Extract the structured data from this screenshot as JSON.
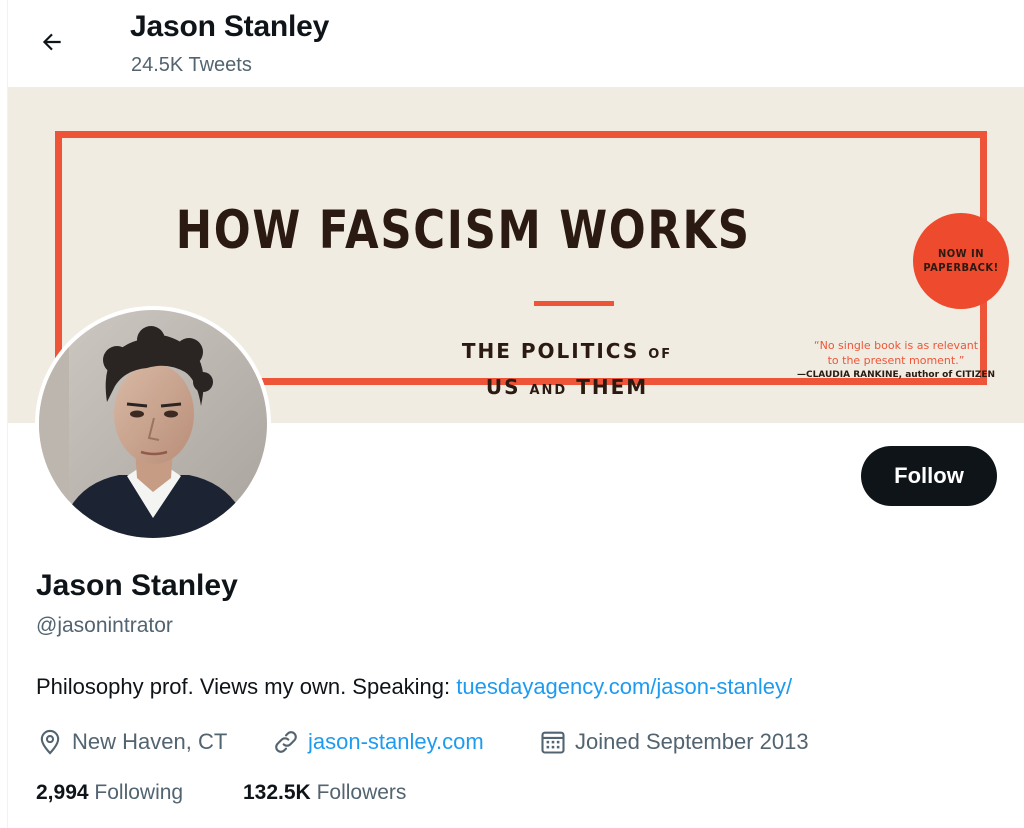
{
  "header": {
    "name": "Jason Stanley",
    "tweet_count": "24.5K Tweets"
  },
  "banner": {
    "title": "HOW FASCISM WORKS",
    "subtitle_line1_main": "THE POLITICS",
    "subtitle_line1_small": "OF",
    "subtitle_line2_a": "US",
    "subtitle_line2_small": "AND",
    "subtitle_line2_b": "THEM",
    "badge_line1": "NOW IN",
    "badge_line2": "PAPERBACK!",
    "quote_line1": "“No single book is as relevant",
    "quote_line2": "to the present moment.”",
    "quote_attribution": "—CLAUDIA RANKINE, author of CITIZEN",
    "frame_color": "#ee5538",
    "background_color": "#f1ece2"
  },
  "follow_button": {
    "label": "Follow"
  },
  "profile": {
    "name": "Jason Stanley",
    "handle": "@jasonintrator",
    "bio_text": "Philosophy prof. Views my own. Speaking: ",
    "bio_link": "tuesdayagency.com/jason-stanley/",
    "location": "New Haven, CT",
    "website": "jason-stanley.com",
    "joined": "Joined September 2013",
    "following_count": "2,994",
    "following_label": "Following",
    "followers_count": "132.5K",
    "followers_label": "Followers"
  },
  "icons": {
    "back": "arrow-left-icon",
    "location": "location-pin-icon",
    "website": "link-icon",
    "joined": "calendar-icon"
  },
  "colors": {
    "accent": "#1d9bf0",
    "text": "#0f1419",
    "secondary": "#536471"
  }
}
